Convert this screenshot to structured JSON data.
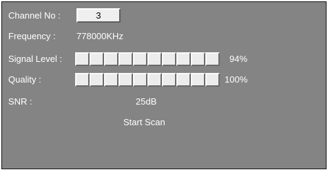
{
  "channel": {
    "label": "Channel No :",
    "value": "3"
  },
  "frequency": {
    "label": "Frequency :",
    "value": "778000KHz"
  },
  "signal": {
    "label": "Signal Level :",
    "value": "94%",
    "level": 0.94,
    "segments": 10
  },
  "quality": {
    "label": "Quality :",
    "value": "100%",
    "level": 1.0,
    "segments": 10
  },
  "snr": {
    "label": "SNR :",
    "value": "25dB"
  },
  "scan": {
    "label": "Start Scan"
  },
  "colors": {
    "panel": "#848484",
    "text": "#ffffff",
    "segment": "#ececec"
  }
}
